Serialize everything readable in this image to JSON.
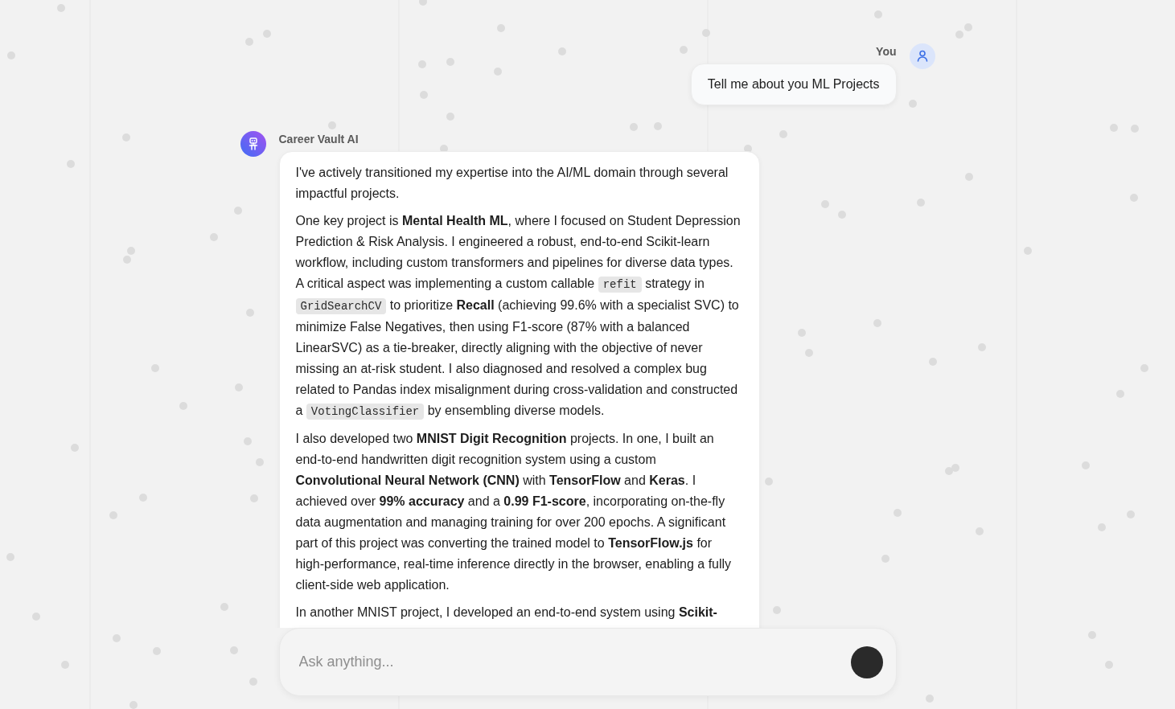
{
  "conversation": [
    {
      "kind": "user",
      "sender": "You",
      "text": "Tell me about you ML Projects"
    },
    {
      "kind": "assistant",
      "sender": "Career Vault AI",
      "paragraphs": [
        {
          "segments": [
            {
              "kind": "text",
              "text": "I've actively transitioned my expertise into the AI/ML domain through several impactful projects."
            }
          ]
        },
        {
          "segments": [
            {
              "kind": "text",
              "text": "One key project is **Mental Health ML**, where I focused on Student Depression Prediction & Risk Analysis. I engineered a robust, end-to-end Scikit-learn workflow, including custom transformers and pipelines for diverse data types. A critical aspect was implementing a custom callable "
            },
            {
              "kind": "code",
              "text": "refit"
            },
            {
              "kind": "text",
              "text": " strategy in "
            },
            {
              "kind": "code",
              "text": "GridSearchCV"
            },
            {
              "kind": "text",
              "text": " to prioritize **Recall** (achieving 99.6% with a specialist SVC) to minimize False Negatives, then using F1-score (87% with a balanced LinearSVC) as a tie-breaker, directly aligning with the objective of never missing an at-risk student. I also diagnosed and resolved a complex bug related to Pandas index misalignment during cross-validation and constructed a "
            },
            {
              "kind": "code",
              "text": "VotingClassifier"
            },
            {
              "kind": "text",
              "text": " by ensembling diverse models."
            }
          ]
        },
        {
          "segments": [
            {
              "kind": "text",
              "text": "I also developed two **MNIST Digit Recognition** projects. In one, I built an end-to-end handwritten digit recognition system using a custom **Convolutional Neural Network (CNN)** with **TensorFlow** and **Keras**. I achieved over **99% accuracy** and a **0.99 F1-score**, incorporating on-the-fly data augmentation and managing training for over 200 epochs. A significant part of this project was converting the trained model to **TensorFlow.js** for high-performance, real-time inference directly in the browser, enabling a fully client-side web application."
            }
          ]
        },
        {
          "segments": [
            {
              "kind": "text",
              "text": "In another MNIST project, I developed an end-to-end system using **Scikit-**"
            }
          ]
        }
      ]
    }
  ],
  "composer": {
    "placeholder": "Ask anything..."
  }
}
